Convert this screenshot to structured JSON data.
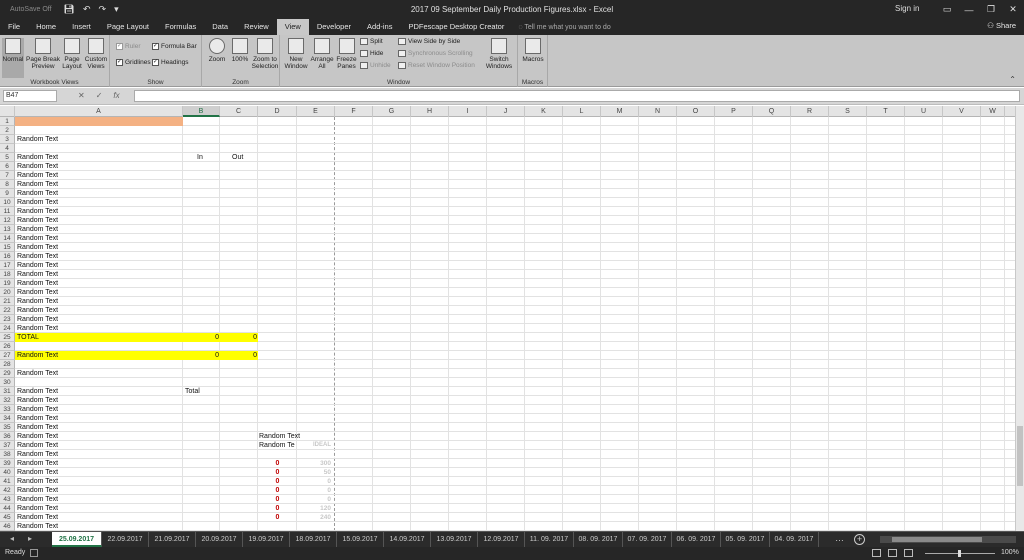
{
  "window": {
    "autosave": "AutoSave",
    "autosave_state": "Off",
    "title": "2017 09 September Daily Production Figures.xlsx  -  Excel",
    "signin": "Sign in",
    "minimize_glyph": "—",
    "restore_glyph": "❐",
    "close_glyph": "✕"
  },
  "qat": {
    "save_icon": "floppy-icon",
    "undo_icon": "undo-icon",
    "redo_icon": "redo-icon"
  },
  "tabs": [
    {
      "label": "File"
    },
    {
      "label": "Home"
    },
    {
      "label": "Insert"
    },
    {
      "label": "Page Layout"
    },
    {
      "label": "Formulas"
    },
    {
      "label": "Data"
    },
    {
      "label": "Review"
    },
    {
      "label": "View",
      "active": true
    },
    {
      "label": "Developer"
    },
    {
      "label": "Add-ins"
    },
    {
      "label": "PDFescape Desktop Creator"
    }
  ],
  "tellme": "Tell me what you want to do",
  "share": "Share",
  "ribbon": {
    "workbook_views": {
      "label": "Workbook Views",
      "normal": "Normal",
      "page_break_preview": "Page Break Preview",
      "page_layout": "Page Layout",
      "custom_views": "Custom Views"
    },
    "show": {
      "label": "Show",
      "ruler": "Ruler",
      "formula_bar": "Formula Bar",
      "gridlines": "Gridlines",
      "headings": "Headings"
    },
    "zoom": {
      "label": "Zoom",
      "zoom": "Zoom",
      "hundred": "100%",
      "zoom_to_selection": "Zoom to Selection"
    },
    "window": {
      "label": "Window",
      "new_window": "New Window",
      "arrange_all": "Arrange All",
      "freeze_panes": "Freeze Panes",
      "split": "Split",
      "hide": "Hide",
      "unhide": "Unhide",
      "view_side_by_side": "View Side by Side",
      "synchronous_scrolling": "Synchronous Scrolling",
      "reset_window_position": "Reset Window Position",
      "switch_windows": "Switch Windows"
    },
    "macros": {
      "label": "Macros",
      "macros": "Macros"
    }
  },
  "formula_bar": {
    "name_box": "B47",
    "cancel": "✕",
    "enter": "✓",
    "fx": "fx",
    "content": ""
  },
  "columns": [
    "A",
    "B",
    "C",
    "D",
    "E",
    "F",
    "G",
    "H",
    "I",
    "J",
    "K",
    "L",
    "M",
    "N",
    "O",
    "P",
    "Q",
    "R",
    "S",
    "T",
    "U",
    "V",
    "W"
  ],
  "rows": [
    "1",
    "2",
    "3",
    "4",
    "5",
    "6",
    "7",
    "8",
    "9",
    "10",
    "11",
    "12",
    "13",
    "14",
    "15",
    "16",
    "17",
    "18",
    "19",
    "20",
    "21",
    "22",
    "23",
    "24",
    "25",
    "26",
    "27",
    "28",
    "29",
    "30",
    "31",
    "32",
    "33",
    "34",
    "35",
    "36",
    "37",
    "38",
    "39",
    "40",
    "41",
    "42",
    "43",
    "44",
    "45",
    "46"
  ],
  "cells": {
    "random_text": "Random Text",
    "in": "In",
    "out": "Out",
    "total_label": "TOTAL",
    "total_in": "0",
    "total_out": "0",
    "r27_in": "0",
    "r27_out": "0",
    "total": "Total",
    "d36": "Random Text",
    "d37": "Random Te",
    "e37": "IDEAL",
    "red_values": [
      "0",
      "0",
      "0",
      "0",
      "0",
      "0",
      "0"
    ],
    "ghost_values": [
      "300",
      "50",
      "0",
      "0",
      "0",
      "120",
      "240"
    ]
  },
  "colors": {
    "accent": "#217346",
    "yellow": "#ffff00",
    "orange": "#f4b183",
    "red": "#c00000"
  },
  "sheet_tabs": [
    "25.09.2017",
    "22.09.2017",
    "21.09.2017",
    "20.09.2017",
    "19.09.2017",
    "18.09.2017",
    "15.09.2017",
    "14.09.2017",
    "13.09.2017",
    "12.09.2017",
    "11. 09. 2017",
    "08. 09. 2017",
    "07. 09. 2017",
    "06. 09. 2017",
    "05. 09. 2017",
    "04. 09. 2017"
  ],
  "status": {
    "ready": "Ready",
    "zoom": "100%"
  }
}
